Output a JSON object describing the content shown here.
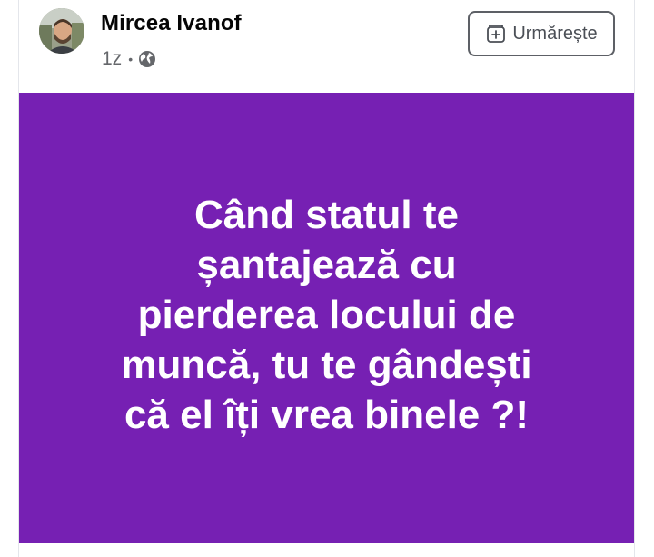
{
  "post": {
    "author_name": "Mircea Ivanof",
    "timestamp": "1z",
    "separator": "•",
    "privacy_icon": "globe-icon",
    "follow_label": "Urmărește",
    "follow_icon": "add-follow-icon",
    "image_background": "#7620b3",
    "image_text_lines": [
      "Când statul te",
      "șantajează cu",
      "pierderea locului de",
      "muncă, tu te gândești",
      "că el îți vrea binele ?!"
    ]
  }
}
